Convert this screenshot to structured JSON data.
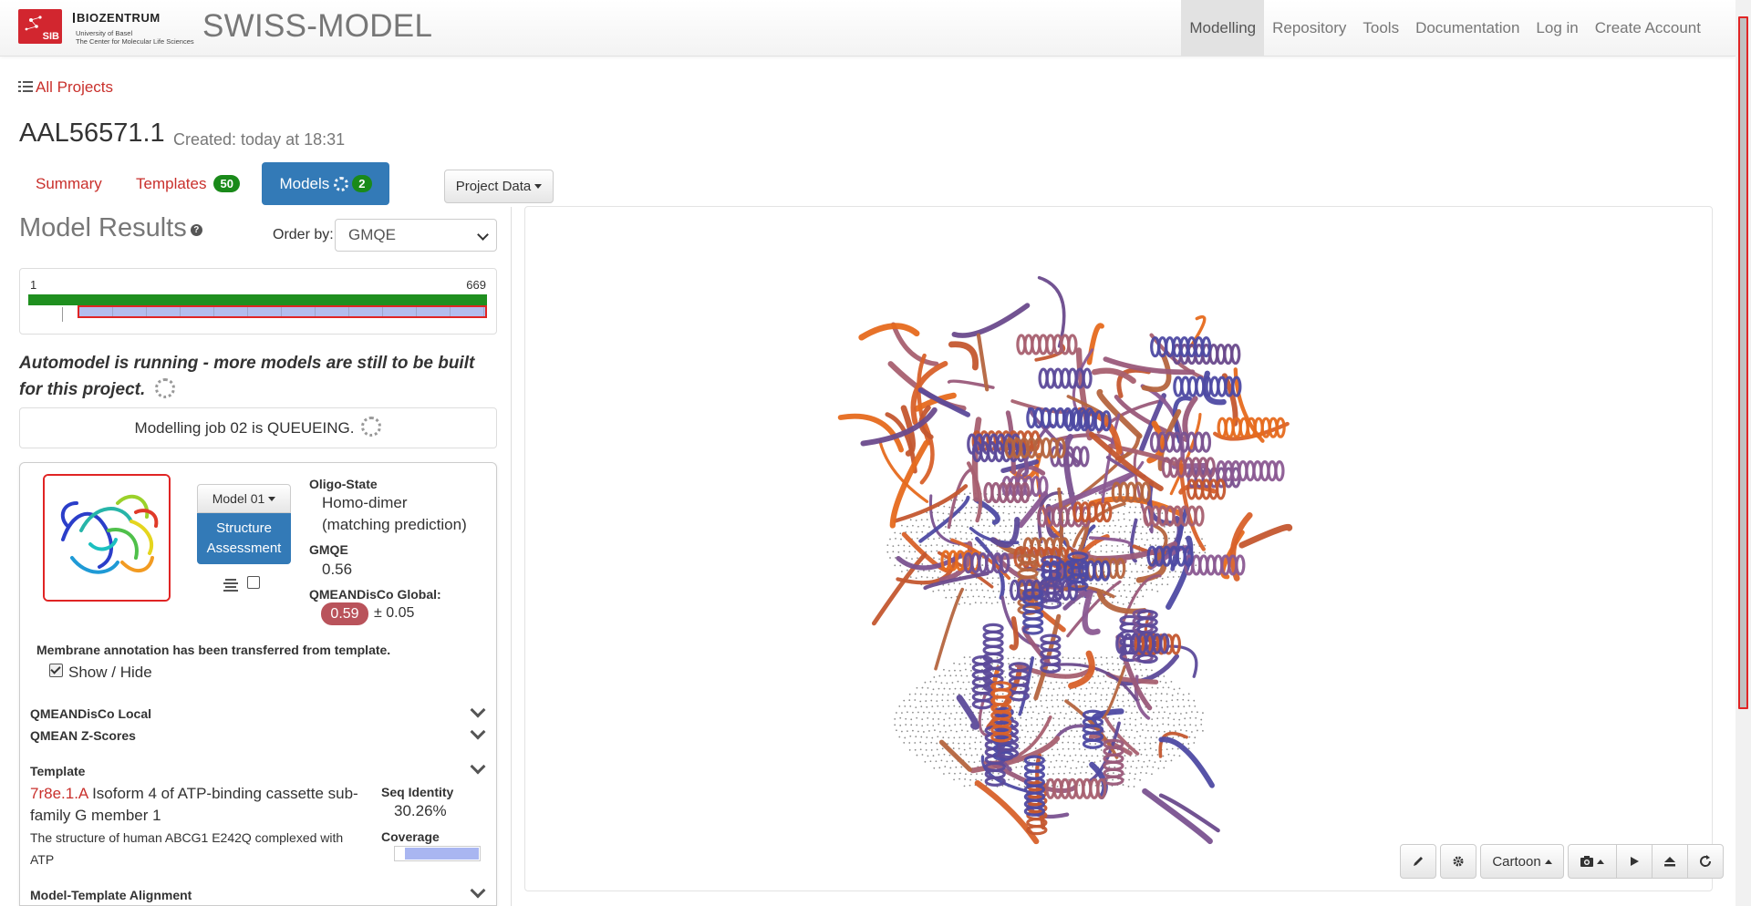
{
  "navbar": {
    "logo_sib": "SIB",
    "logo_biozentrum_title": "BIOZENTRUM",
    "logo_biozentrum_sub1": "University of Basel",
    "logo_biozentrum_sub2": "The Center for Molecular Life Sciences",
    "brand": "SWISS-MODEL",
    "items": [
      {
        "label": "Modelling",
        "active": true
      },
      {
        "label": "Repository"
      },
      {
        "label": "Tools"
      },
      {
        "label": "Documentation"
      },
      {
        "label": "Log in"
      },
      {
        "label": "Create Account"
      }
    ]
  },
  "breadcrumb": {
    "all_projects": "All Projects"
  },
  "project": {
    "title": "AAL56571.1",
    "created": "Created: today at 18:31"
  },
  "tabs": {
    "summary": "Summary",
    "templates": "Templates",
    "templates_count": "50",
    "models": "Models",
    "models_count": "2"
  },
  "project_data_button": "Project Data",
  "results": {
    "heading": "Model Results",
    "order_by_label": "Order by:",
    "order_by_value": "GMQE",
    "coverage_start": "1",
    "coverage_end": "669",
    "automodel_message": "Automodel is running - more models are still to be built for this project.",
    "queue_message": "Modelling job 02 is QUEUEING."
  },
  "model": {
    "dropdown_label": "Model 01",
    "structure_assessment": "Structure Assessment",
    "oligo_state_label": "Oligo-State",
    "oligo_state_value": "Homo-dimer",
    "oligo_state_note": "(matching prediction)",
    "gmqe_label": "GMQE",
    "gmqe_value": "0.56",
    "qmean_label": "QMEANDisCo Global:",
    "qmean_value": "0.59",
    "qmean_error": "± 0.05",
    "membrane_note": "Membrane annotation has been transferred from template.",
    "show_hide": "Show / Hide",
    "sections": {
      "qmean_local": "QMEANDisCo Local",
      "qmean_z": "QMEAN Z-Scores",
      "template": "Template",
      "alignment": "Model-Template Alignment"
    },
    "template": {
      "id": "7r8e.1.A",
      "name": "Isoform 4 of ATP-binding cassette sub-family G member 1",
      "description": "The structure of human ABCG1 E242Q complexed with ATP",
      "seq_identity_label": "Seq Identity",
      "seq_identity_value": "30.26%",
      "coverage_label": "Coverage",
      "coverage_fraction": 0.88
    }
  },
  "viewer": {
    "representation": "Cartoon",
    "tools": [
      "pencil-icon",
      "gear-icon",
      "camera-icon",
      "play-icon",
      "eject-icon",
      "refresh-icon"
    ]
  },
  "colors": {
    "link_red": "#c9302c",
    "primary_blue": "#337ab7",
    "badge_green": "#1a8a1a",
    "qmean_badge": "#b9535b",
    "template_coverage": "#b3bdee"
  }
}
